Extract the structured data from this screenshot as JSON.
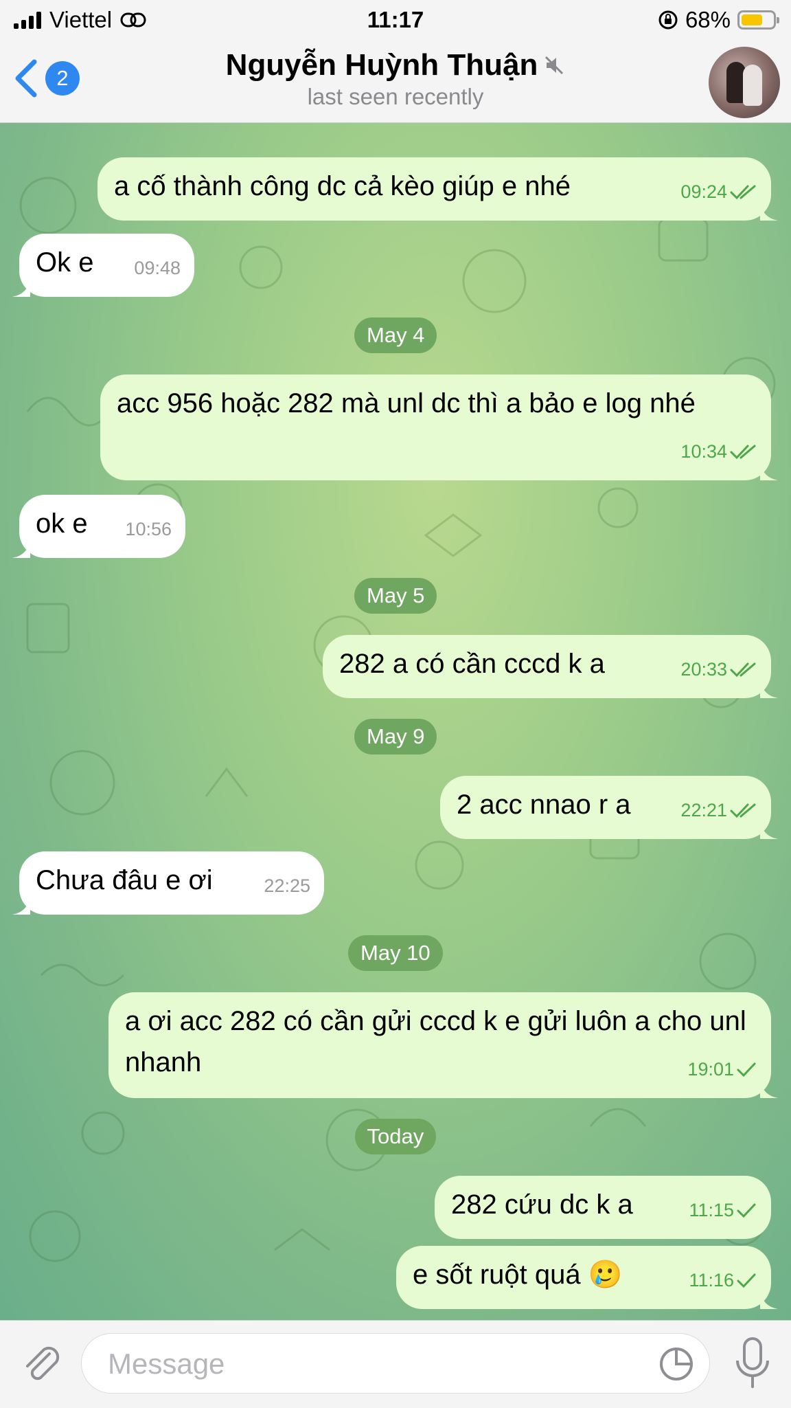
{
  "status": {
    "carrier": "Viettel",
    "time": "11:17",
    "battery": "68%",
    "battery_level": 0.68
  },
  "header": {
    "back_count": "2",
    "name": "Nguyễn Huỳnh Thuận",
    "last_seen": "last seen recently",
    "muted_icon": "muted-speaker-icon"
  },
  "colors": {
    "outgoing_bubble": "#e6fbd2",
    "incoming_bubble": "#ffffff",
    "check_green": "#4da748",
    "date_pill": "#6fa660",
    "accent_blue": "#2f88f0"
  },
  "messages": [
    {
      "type": "out",
      "text": "a cố thành công dc cả kèo giúp e nhé",
      "time": "09:24",
      "status": "read"
    },
    {
      "type": "in",
      "text": "Ok e",
      "time": "09:48"
    },
    {
      "type": "date",
      "text": "May 4"
    },
    {
      "type": "out",
      "text": "acc 956 hoặc 282 mà unl dc thì a bảo e log nhé",
      "time": "10:34",
      "status": "read"
    },
    {
      "type": "in",
      "text": "ok e",
      "time": "10:56"
    },
    {
      "type": "date",
      "text": "May 5"
    },
    {
      "type": "out",
      "text": "282 a có cần cccd k a",
      "time": "20:33",
      "status": "read"
    },
    {
      "type": "date",
      "text": "May 9"
    },
    {
      "type": "out",
      "text": "2 acc nnao r a",
      "time": "22:21",
      "status": "read"
    },
    {
      "type": "in",
      "text": "Chưa đâu e ơi",
      "time": "22:25"
    },
    {
      "type": "date",
      "text": "May 10"
    },
    {
      "type": "out",
      "text": "a ơi acc 282 có cần gửi cccd k e gửi luôn a cho unl nhanh",
      "time": "19:01",
      "status": "sent"
    },
    {
      "type": "date",
      "text": "Today"
    },
    {
      "type": "out",
      "text": "282 cứu dc k a",
      "time": "11:15",
      "status": "sent"
    },
    {
      "type": "out",
      "text": "e sốt ruột quá 🥲",
      "time": "11:16",
      "status": "sent"
    }
  ],
  "input": {
    "placeholder": "Message"
  }
}
